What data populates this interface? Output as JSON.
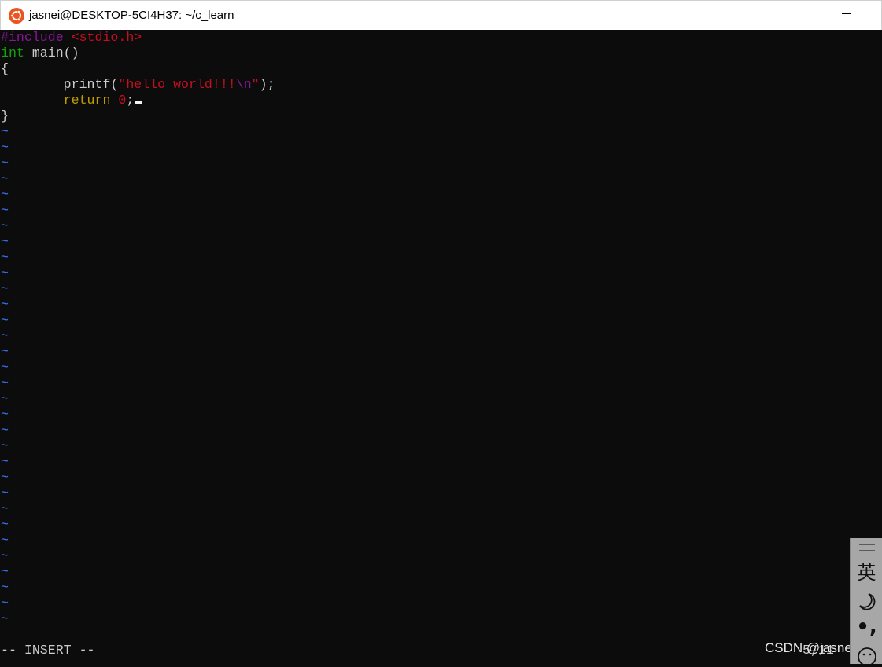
{
  "window": {
    "title": "jasnei@DESKTOP-5CI4H37: ~/c_learn",
    "app_icon": "ubuntu-icon",
    "minimize_icon": "minimize-icon"
  },
  "editor": {
    "code": [
      {
        "parts": [
          {
            "text": "#include ",
            "color": "purple"
          },
          {
            "text": "<stdio.h>",
            "color": "red"
          }
        ]
      },
      {
        "parts": [
          {
            "text": "int",
            "color": "green"
          },
          {
            "text": " main()",
            "color": "white"
          }
        ]
      },
      {
        "parts": [
          {
            "text": "{",
            "color": "white"
          }
        ]
      },
      {
        "parts": [
          {
            "text": "        printf(",
            "color": "white"
          },
          {
            "text": "\"hello world!!!",
            "color": "red"
          },
          {
            "text": "\\n",
            "color": "purple"
          },
          {
            "text": "\"",
            "color": "red"
          },
          {
            "text": ");",
            "color": "white"
          }
        ]
      },
      {
        "parts": [
          {
            "text": "        return ",
            "color": "orange"
          },
          {
            "text": "0",
            "color": "red"
          },
          {
            "text": ";",
            "color": "white"
          }
        ],
        "cursor": true
      },
      {
        "parts": [
          {
            "text": "}",
            "color": "white"
          }
        ]
      }
    ],
    "tilde_char": "~",
    "tilde_count": 32,
    "mode": "-- INSERT --",
    "position": "5,11",
    "colors": {
      "purple": "#881798",
      "red": "#c50f1f",
      "green": "#13a10e",
      "orange": "#c19c00",
      "white": "#cccccc",
      "tilde": "#3b78ff"
    }
  },
  "watermark": "CSDN @jasneik",
  "ime": {
    "language": "英",
    "punct": "•,",
    "icons": [
      "moon-icon",
      "emoji-icon"
    ]
  }
}
